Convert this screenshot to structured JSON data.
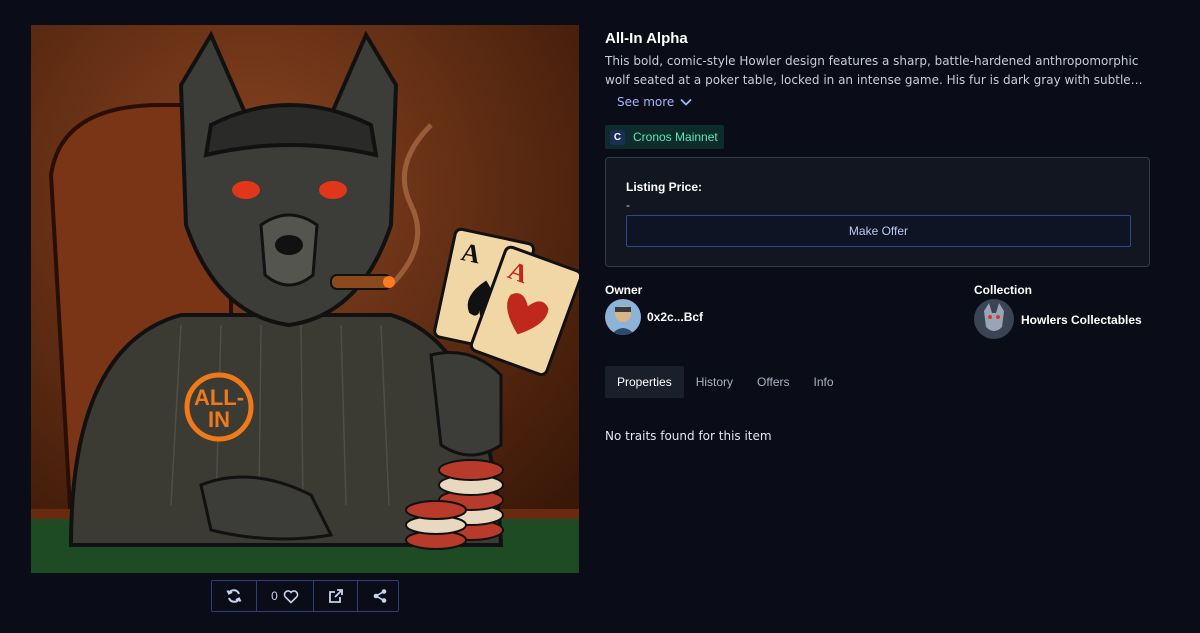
{
  "item": {
    "title": "All-In Alpha",
    "description": "This bold, comic-style Howler design features a sharp, battle-hardened anthropomorphic wolf seated at a poker table, locked in an intense game. His fur is dark gray with subtle card-suit…",
    "see_more_label": "See more",
    "chain_label": "Cronos Mainnet",
    "chain_icon_letter": "C",
    "badge_text": "ALL-\nIN",
    "badge_line1": "ALL-",
    "badge_line2": "IN",
    "card_rank": "A"
  },
  "actions": {
    "like_count": "0"
  },
  "listing": {
    "label": "Listing Price:",
    "value": "-",
    "offer_button": "Make Offer"
  },
  "owner": {
    "label": "Owner",
    "address": "0x2c...Bcf"
  },
  "collection": {
    "label": "Collection",
    "name": "Howlers Collectables"
  },
  "tabs": [
    {
      "label": "Properties",
      "active": true
    },
    {
      "label": "History",
      "active": false
    },
    {
      "label": "Offers",
      "active": false
    },
    {
      "label": "Info",
      "active": false
    }
  ],
  "properties": {
    "empty_text": "No traits found for this item"
  },
  "colors": {
    "background": "#0a0d17",
    "accent_link": "#9fb6ff",
    "chain_text": "#5ce7b6",
    "badge_orange": "#f07a1a"
  },
  "icons": [
    "refresh-icon",
    "heart-icon",
    "external-link-icon",
    "share-icon",
    "chevron-down-icon",
    "cronos-icon"
  ]
}
